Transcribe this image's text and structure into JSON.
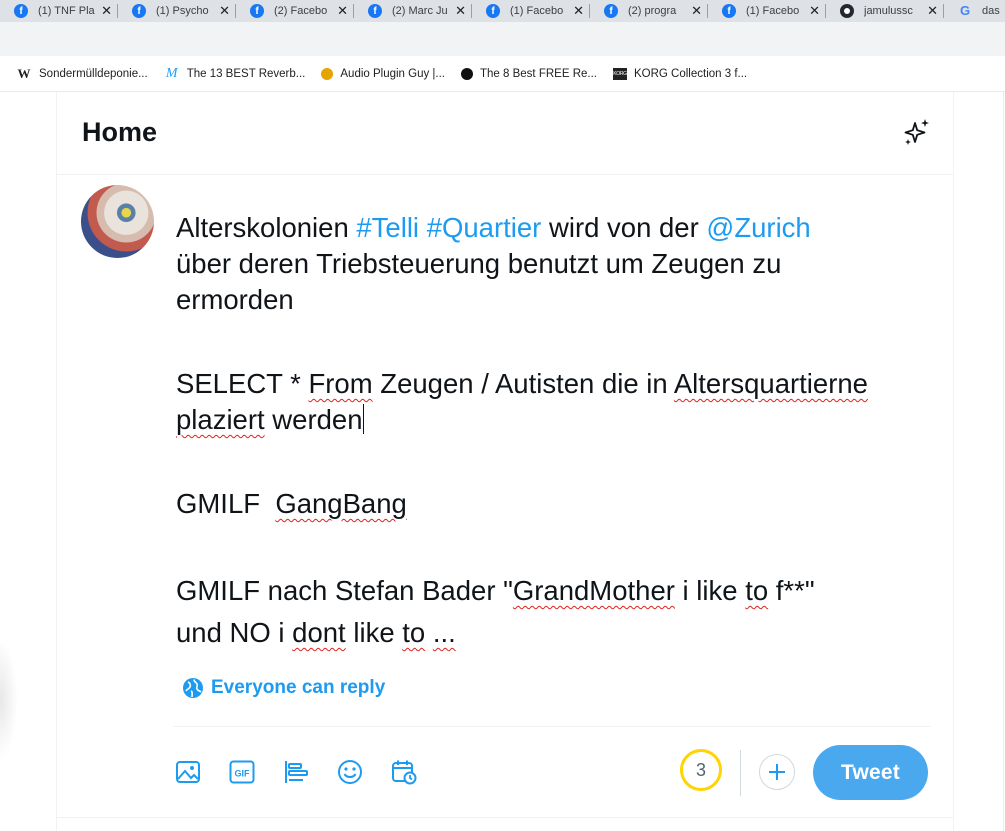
{
  "browser": {
    "tabs": [
      {
        "title": "(1) TNF Pla",
        "icon": "facebook-icon"
      },
      {
        "title": "(1) Psycho",
        "icon": "facebook-icon"
      },
      {
        "title": "(2) Facebo",
        "icon": "facebook-icon"
      },
      {
        "title": "(2) Marc Ju",
        "icon": "facebook-icon"
      },
      {
        "title": "(1) Facebo",
        "icon": "facebook-icon"
      },
      {
        "title": "(2) progra",
        "icon": "facebook-icon"
      },
      {
        "title": "(1) Facebo",
        "icon": "facebook-icon"
      },
      {
        "title": "jamulussc",
        "icon": "github-icon"
      },
      {
        "title": "das",
        "icon": "google-icon"
      }
    ],
    "tab_close_glyph": "✕",
    "bookmarks": [
      {
        "label": "Sondermülldeponie...",
        "icon": "wikipedia-icon",
        "glyph": "W"
      },
      {
        "label": "The 13 BEST Reverb...",
        "icon": "m-logo-icon",
        "glyph": "M"
      },
      {
        "label": "Audio Plugin Guy |...",
        "icon": "audio-plugin-guy-icon",
        "glyph": ""
      },
      {
        "label": "The 8 Best FREE Re...",
        "icon": "site-icon",
        "glyph": ""
      },
      {
        "label": "KORG Collection 3 f...",
        "icon": "korg-icon",
        "glyph": "KORG"
      }
    ]
  },
  "header": {
    "title": "Home",
    "sparkle_icon": "sparkle-icon"
  },
  "composer": {
    "line1_plain1": "Alterskolonien ",
    "line1_tag1": "#Telli",
    "line1_space": " ",
    "line1_tag2": "#Quartier",
    "line1_plain2": " wird von der ",
    "line1_mention": "@Zurich",
    "line2": "über deren Triebsteuerung benutzt um Zeugen zu",
    "line3": "ermorden",
    "line4_a": "SELECT * ",
    "line4_b": "From",
    "line4_c": " Zeugen / Autisten die in ",
    "line4_d": "Altersquartierne",
    "line5_a": "plaziert",
    "line5_b": " werden",
    "line6_a": "GMILF  ",
    "line6_b": "GangBang",
    "line7_a": "GMILF nach Stefan Bader \"",
    "line7_b": "GrandMother",
    "line7_c": " i like ",
    "line7_d": "to",
    "line7_e": " f**\"",
    "line8_a": "und NO i ",
    "line8_b": "dont",
    "line8_c": " like ",
    "line8_d": "to",
    "line8_e": " ",
    "line8_f": "..."
  },
  "reply_setting": {
    "label": "Everyone can reply",
    "icon": "globe-icon"
  },
  "toolbar": {
    "icons": [
      "image-icon",
      "gif-icon",
      "poll-icon",
      "emoji-icon",
      "schedule-icon"
    ],
    "gif_label": "GIF",
    "char_counter": "3",
    "add_icon": "plus-icon",
    "tweet_label": "Tweet"
  },
  "colors": {
    "accent": "#1d9bf0",
    "tweet_button": "#4aa8ef",
    "counter_ring": "#ffd400",
    "spell_underline": "#e0201b"
  }
}
